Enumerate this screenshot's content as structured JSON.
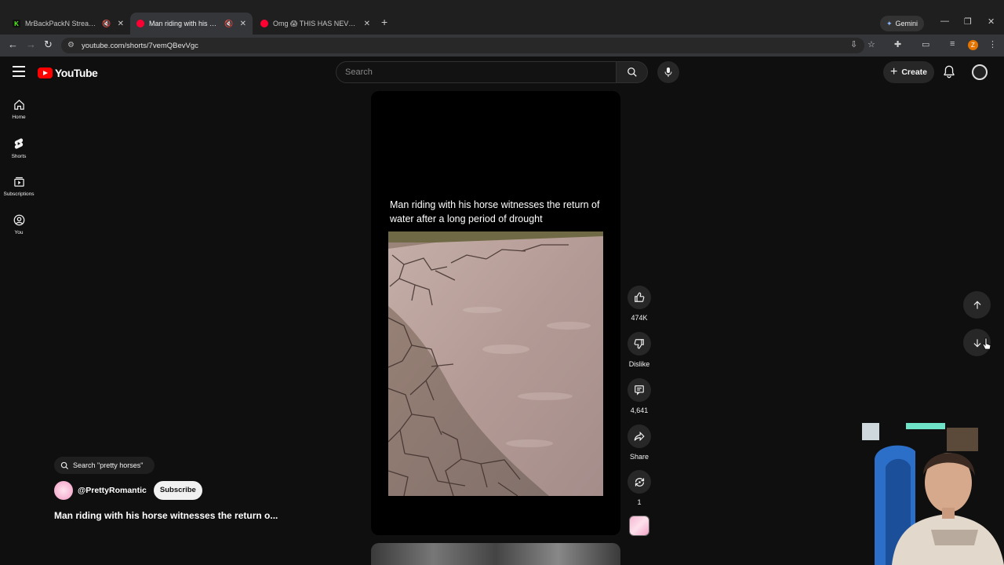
{
  "browser": {
    "tabs": [
      {
        "title": "MrBackPackN Stream - Wa",
        "favicon": "kick-icon",
        "color": "#53fc18",
        "active": false,
        "muted": true
      },
      {
        "title": "Man riding with his horse w",
        "favicon": "youtube-icon",
        "color": "#ff0033",
        "active": true,
        "muted": true
      },
      {
        "title": "Omg 😱 THIS HAS NEVER HAP",
        "favicon": "youtube-icon",
        "color": "#ff0033",
        "active": false,
        "muted": false
      }
    ],
    "new_tab": "+",
    "gemini_label": "Gemini",
    "url": "youtube.com/shorts/7vemQBevVgc",
    "profile_initial": "Z"
  },
  "youtube": {
    "logo_text": "YouTube",
    "search_placeholder": "Search",
    "create_label": "Create",
    "sidebar": [
      {
        "label": "Home",
        "icon": "home-icon"
      },
      {
        "label": "Shorts",
        "icon": "shorts-icon"
      },
      {
        "label": "Subscriptions",
        "icon": "subscriptions-icon"
      },
      {
        "label": "You",
        "icon": "you-icon"
      }
    ],
    "short": {
      "caption": "Man riding with his horse witnesses the return of water after a long period of drought",
      "search_chip": "Search \"pretty horses\"",
      "channel": "@PrettyRomantic",
      "subscribe_label": "Subscribe",
      "title": "Man riding with his horse witnesses the return o..."
    },
    "actions": {
      "likes": "474K",
      "dislike_label": "Dislike",
      "comments": "4,641",
      "share_label": "Share",
      "remix_count": "1"
    }
  },
  "colors": {
    "accent": "#ff0000",
    "background": "#0f0f0f",
    "button_bg": "#272727"
  }
}
